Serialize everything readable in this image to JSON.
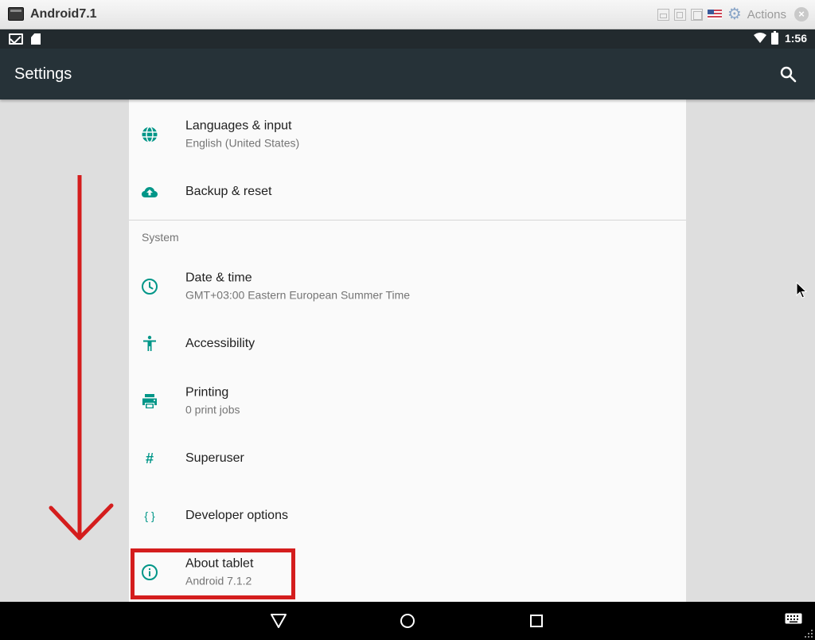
{
  "window": {
    "title": "Android7.1",
    "actions_label": "Actions"
  },
  "status_bar": {
    "time": "1:56",
    "icons": [
      "gmail-icon",
      "sd-card-icon",
      "wifi-icon",
      "battery-icon"
    ]
  },
  "app_bar": {
    "title": "Settings",
    "search_icon": "search-icon"
  },
  "settings": {
    "items_top": [
      {
        "title": "Languages & input",
        "subtitle": "English (United States)",
        "icon": "globe-icon"
      },
      {
        "title": "Backup & reset",
        "subtitle": "",
        "icon": "cloud-upload-icon"
      }
    ],
    "section_header": "System",
    "items_system": [
      {
        "title": "Date & time",
        "subtitle": "GMT+03:00 Eastern European Summer Time",
        "icon": "clock-icon"
      },
      {
        "title": "Accessibility",
        "subtitle": "",
        "icon": "accessibility-icon"
      },
      {
        "title": "Printing",
        "subtitle": "0 print jobs",
        "icon": "printer-icon"
      },
      {
        "title": "Superuser",
        "subtitle": "",
        "icon": "hash-icon",
        "glyph": "#"
      },
      {
        "title": "Developer options",
        "subtitle": "",
        "icon": "braces-icon",
        "glyph": "{ }"
      },
      {
        "title": "About tablet",
        "subtitle": "Android 7.1.2",
        "icon": "info-icon"
      }
    ]
  },
  "nav_bar": {
    "icons": [
      "back-icon",
      "home-icon",
      "recents-icon",
      "keyboard-icon"
    ]
  },
  "colors": {
    "accent": "#009688",
    "app_bar": "#263238",
    "status_bar": "#222a2e",
    "annotation": "#d41d1d"
  }
}
